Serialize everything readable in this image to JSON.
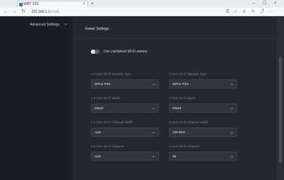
{
  "browser": {
    "tab_title": "WRT 32X",
    "new_tab": "+",
    "address": "192.168.1.1",
    "address_path": "/#/wifi",
    "icons": {
      "back": "←",
      "forward": "→",
      "refresh": "↻",
      "tab_close": "×",
      "minimize": "–",
      "maximize": "☐",
      "close": "×",
      "reader": "☰",
      "favorite": "☆",
      "hub": "≡",
      "notes": "✎",
      "share": "⤴",
      "more": "···"
    }
  },
  "sidebar": {
    "item_label": "Advanced Settings",
    "chevron": "⌄"
  },
  "content": {
    "section_title": "Fewer Settings",
    "combined_toggle_label": "Use combined Wi-Fi names",
    "left": {
      "security_label": "2.4 GHz Wi-Fi Security Type",
      "security_value": "WPA2 PSK",
      "mode_label": "2.4 GHz Wi-Fi Mode",
      "mode_value": "Mixed",
      "width_label": "2.4 GHz Wi-Fi Channel Width",
      "width_value": "Auto",
      "channel_label": "2.4 GHz Wi-Fi Channel",
      "channel_value": "Auto"
    },
    "right": {
      "security_label": "5 GHz Wi-Fi Security Type",
      "security_value": "WPA2 PSK",
      "mode_label": "5 GHz Wi-Fi Mode",
      "mode_value": "Mixed",
      "width_label": "5 GHz Wi-Fi Channel Width",
      "width_value": "160 MHz",
      "channel_label": "5 GHz Wi-Fi Channel",
      "channel_value": "36"
    },
    "select_chevron": "⌄"
  },
  "colors": {
    "page_bg": "#1e222a",
    "panel_bg": "#23272f",
    "select_bg": "#2f343d"
  }
}
